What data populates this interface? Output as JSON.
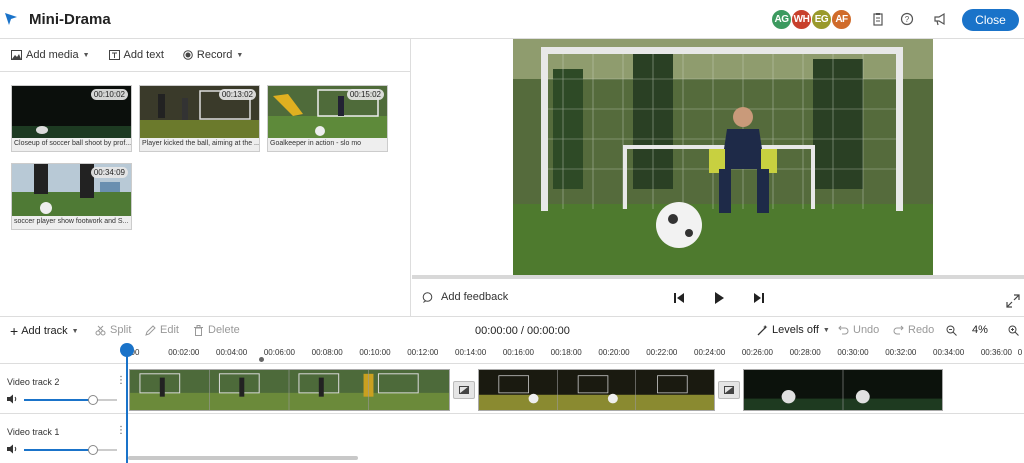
{
  "header": {
    "title": "Mini-Drama",
    "avatars": [
      {
        "initials": "AG",
        "color": "#3c9a5f"
      },
      {
        "initials": "WH",
        "color": "#c8402c"
      },
      {
        "initials": "EG",
        "color": "#9a9a2c"
      },
      {
        "initials": "AF",
        "color": "#d06b2a"
      }
    ],
    "icons": [
      "clipboard-icon",
      "help-icon",
      "announcement-icon"
    ],
    "close_label": "Close"
  },
  "media_toolbar": {
    "add_media": "Add media",
    "add_text": "Add text",
    "record": "Record"
  },
  "media_clips": [
    {
      "duration": "00:10:02",
      "caption": "Closeup of soccer ball shoot by prof..."
    },
    {
      "duration": "00:13:02",
      "caption": "Player kicked the ball, aiming at the ..."
    },
    {
      "duration": "00:15:02",
      "caption": "Goalkeeper in action - slo mo"
    },
    {
      "duration": "00:34:09",
      "caption": "soccer player show footwork and S..."
    }
  ],
  "preview": {
    "feedback_label": "Add feedback"
  },
  "timeline_toolbar": {
    "add_track": "Add track",
    "split": "Split",
    "edit": "Edit",
    "delete": "Delete",
    "timecode": "00:00:00 / 00:00:00",
    "levels": "Levels off",
    "undo": "Undo",
    "redo": "Redo",
    "zoom": "4%"
  },
  "ruler_ticks": [
    "00",
    "00:02:00",
    "00:04:00",
    "00:06:00",
    "00:08:00",
    "00:10:00",
    "00:12:00",
    "00:14:00",
    "00:16:00",
    "00:18:00",
    "00:20:00",
    "00:22:00",
    "00:24:00",
    "00:26:00",
    "00:28:00",
    "00:30:00",
    "00:32:00",
    "00:34:00",
    "00:36:00",
    "0"
  ],
  "tracks": [
    {
      "name": "Video track 2",
      "volume": 0.74
    },
    {
      "name": "Video track 1",
      "volume": 0.74
    }
  ],
  "colors": {
    "accent": "#1a73c9"
  }
}
